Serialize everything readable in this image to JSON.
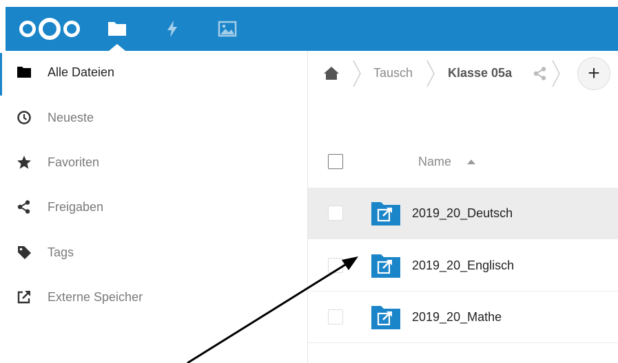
{
  "header": {
    "accent_color": "#1b85c9",
    "logo_icon": "nextcloud-logo",
    "apps": [
      {
        "name": "files",
        "icon": "folder-icon",
        "active": true
      },
      {
        "name": "activity",
        "icon": "lightning-icon",
        "active": false
      },
      {
        "name": "photos",
        "icon": "image-icon",
        "active": false
      }
    ]
  },
  "sidebar": {
    "items": [
      {
        "label": "Alle Dateien",
        "icon": "folder-icon",
        "active": true
      },
      {
        "label": "Neueste",
        "icon": "clock-icon",
        "active": false
      },
      {
        "label": "Favoriten",
        "icon": "star-icon",
        "active": false
      },
      {
        "label": "Freigaben",
        "icon": "share-icon",
        "active": false
      },
      {
        "label": "Tags",
        "icon": "tag-icon",
        "active": false
      },
      {
        "label": "Externe Speicher",
        "icon": "external-link-icon",
        "active": false
      }
    ]
  },
  "breadcrumb": {
    "home_icon": "home-icon",
    "items": [
      "Tausch",
      "Klasse 05a"
    ],
    "share_icon": "share-icon",
    "add_label": "+"
  },
  "file_list": {
    "column_name": "Name",
    "sort": "ascending",
    "rows": [
      {
        "name": "2019_20_Deutsch",
        "icon": "external-folder-icon",
        "hover": true
      },
      {
        "name": "2019_20_Englisch",
        "icon": "external-folder-icon",
        "hover": false
      },
      {
        "name": "2019_20_Mathe",
        "icon": "external-folder-icon",
        "hover": false
      }
    ]
  },
  "annotation": {
    "type": "arrow",
    "color": "#000000",
    "points_to": "2019_20_Englisch"
  }
}
